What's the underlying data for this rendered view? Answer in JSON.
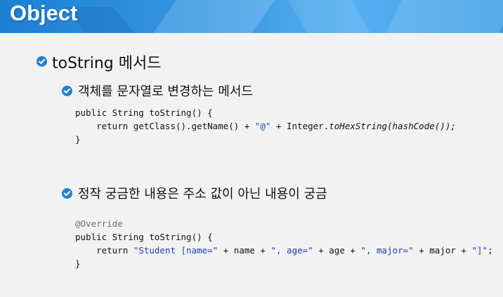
{
  "header": {
    "title": "Object"
  },
  "section": {
    "title": "toString 메서드",
    "items": [
      {
        "label": "객체를 문자열로 변경하는 메서드"
      },
      {
        "label": "정작 궁금한 내용은 주소 값이 아닌 내용이 궁금"
      }
    ]
  },
  "code1": {
    "line1": "public String toString() {",
    "line2_a": "    return getClass().getName() + ",
    "line2_str": "\"@\"",
    "line2_b": " + Integer.",
    "line2_it": "toHexString(hashCode());",
    "line3": "}"
  },
  "code2": {
    "annotation": "@Override",
    "line1": "public String toString() {",
    "line2_a": "    return ",
    "line2_s1": "\"Student [name=\"",
    "line2_b": " + name + ",
    "line2_s2": "\", age=\"",
    "line2_c": " + age + ",
    "line2_s3": "\", major=\"",
    "line2_d": " + major + ",
    "line2_s4": "\"]\"",
    "line2_e": ";",
    "line3": "}"
  },
  "colors": {
    "accent": "#2480d6",
    "header_start": "#1c7fd2",
    "header_end": "#55aff0"
  }
}
